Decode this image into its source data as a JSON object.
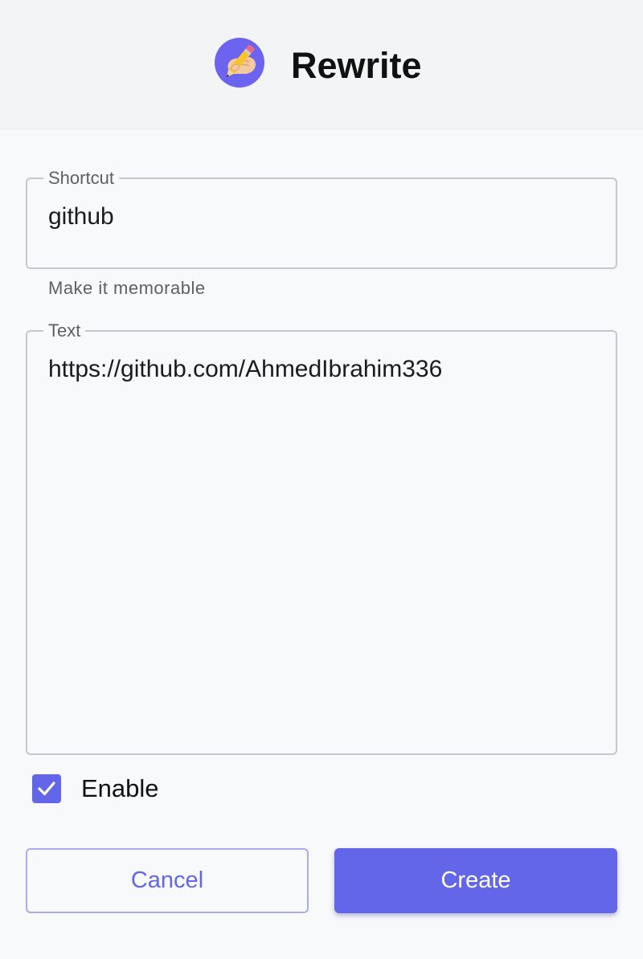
{
  "header": {
    "title": "Rewrite",
    "logo_icon": "hand-writing-pencil-icon"
  },
  "form": {
    "shortcut": {
      "label": "Shortcut",
      "value": "github",
      "helper": "Make it memorable"
    },
    "text": {
      "label": "Text",
      "value": "https://github.com/AhmedIbrahim336"
    },
    "enable": {
      "label": "Enable",
      "checked": true
    }
  },
  "actions": {
    "cancel_label": "Cancel",
    "create_label": "Create"
  },
  "colors": {
    "accent": "#6366e8",
    "header_bg": "#f3f4f6",
    "page_bg": "#f8f9fb"
  }
}
